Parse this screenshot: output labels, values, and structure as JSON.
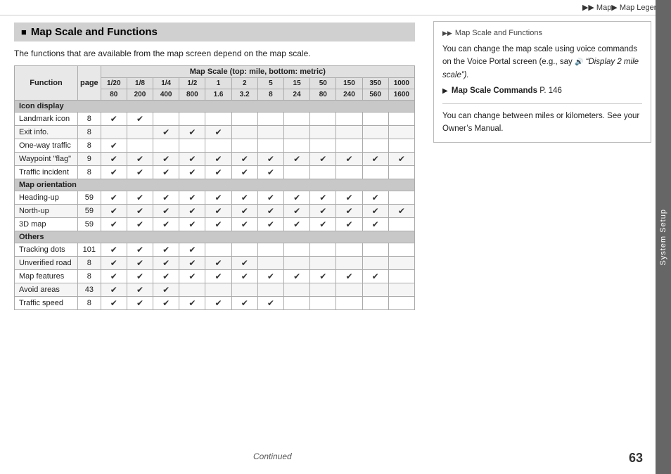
{
  "header": {
    "breadcrumb": "▶▶ Map▶ Map Legend"
  },
  "sidebar": {
    "label": "System Setup"
  },
  "page": {
    "number": "63",
    "continued": "Continued"
  },
  "section": {
    "title": "Map Scale and Functions",
    "intro": "The functions that are available from the map screen depend on the map scale."
  },
  "table": {
    "col_function": "Function",
    "col_page": "page",
    "scale_header": "Map Scale (top: mile, bottom: metric)",
    "scale_cols": [
      "1/20",
      "1/8",
      "1/4",
      "1/2",
      "1",
      "2",
      "5",
      "15",
      "50",
      "150",
      "350",
      "1000"
    ],
    "scale_cols2": [
      "80",
      "200",
      "400",
      "800",
      "1.6",
      "3.2",
      "8",
      "24",
      "80",
      "240",
      "560",
      "1600"
    ],
    "sections": [
      {
        "name": "Icon display",
        "rows": [
          {
            "function": "Landmark icon",
            "page": "8",
            "checks": [
              1,
              1,
              0,
              0,
              0,
              0,
              0,
              0,
              0,
              0,
              0,
              0
            ]
          },
          {
            "function": "Exit info.",
            "page": "8",
            "checks": [
              0,
              0,
              1,
              1,
              1,
              0,
              0,
              0,
              0,
              0,
              0,
              0
            ]
          },
          {
            "function": "One-way traffic",
            "page": "8",
            "checks": [
              1,
              0,
              0,
              0,
              0,
              0,
              0,
              0,
              0,
              0,
              0,
              0
            ]
          },
          {
            "function": "Waypoint \"flag\"",
            "page": "9",
            "checks": [
              1,
              1,
              1,
              1,
              1,
              1,
              1,
              1,
              1,
              1,
              1,
              1
            ]
          },
          {
            "function": "Traffic incident",
            "page": "8",
            "checks": [
              1,
              1,
              1,
              1,
              1,
              1,
              1,
              0,
              0,
              0,
              0,
              0
            ]
          }
        ]
      },
      {
        "name": "Map orientation",
        "rows": [
          {
            "function": "Heading-up",
            "page": "59",
            "checks": [
              1,
              1,
              1,
              1,
              1,
              1,
              1,
              1,
              1,
              1,
              1,
              0
            ]
          },
          {
            "function": "North-up",
            "page": "59",
            "checks": [
              1,
              1,
              1,
              1,
              1,
              1,
              1,
              1,
              1,
              1,
              1,
              1
            ]
          },
          {
            "function": "3D map",
            "page": "59",
            "checks": [
              1,
              1,
              1,
              1,
              1,
              1,
              1,
              1,
              1,
              1,
              1,
              0
            ]
          }
        ]
      },
      {
        "name": "Others",
        "rows": [
          {
            "function": "Tracking dots",
            "page": "101",
            "checks": [
              1,
              1,
              1,
              1,
              0,
              0,
              0,
              0,
              0,
              0,
              0,
              0
            ]
          },
          {
            "function": "Unverified road",
            "page": "8",
            "checks": [
              1,
              1,
              1,
              1,
              1,
              1,
              0,
              0,
              0,
              0,
              0,
              0
            ]
          },
          {
            "function": "Map features",
            "page": "8",
            "checks": [
              1,
              1,
              1,
              1,
              1,
              1,
              1,
              1,
              1,
              1,
              1,
              0
            ]
          },
          {
            "function": "Avoid areas",
            "page": "43",
            "checks": [
              1,
              1,
              1,
              0,
              0,
              0,
              0,
              0,
              0,
              0,
              0,
              0
            ]
          },
          {
            "function": "Traffic speed",
            "page": "8",
            "checks": [
              1,
              1,
              1,
              1,
              1,
              1,
              1,
              0,
              0,
              0,
              0,
              0
            ]
          }
        ]
      }
    ]
  },
  "right_panel": {
    "title": "Map Scale and Functions",
    "para1": "You can change the map scale using voice commands on the Voice Portal screen (e.g., say",
    "para1_quote": "“Display 2 mile scale”).",
    "cmd_label": "Map Scale Commands",
    "cmd_page": "P. 146",
    "para2": "You can change between miles or kilometers. See your Owner’s Manual."
  }
}
